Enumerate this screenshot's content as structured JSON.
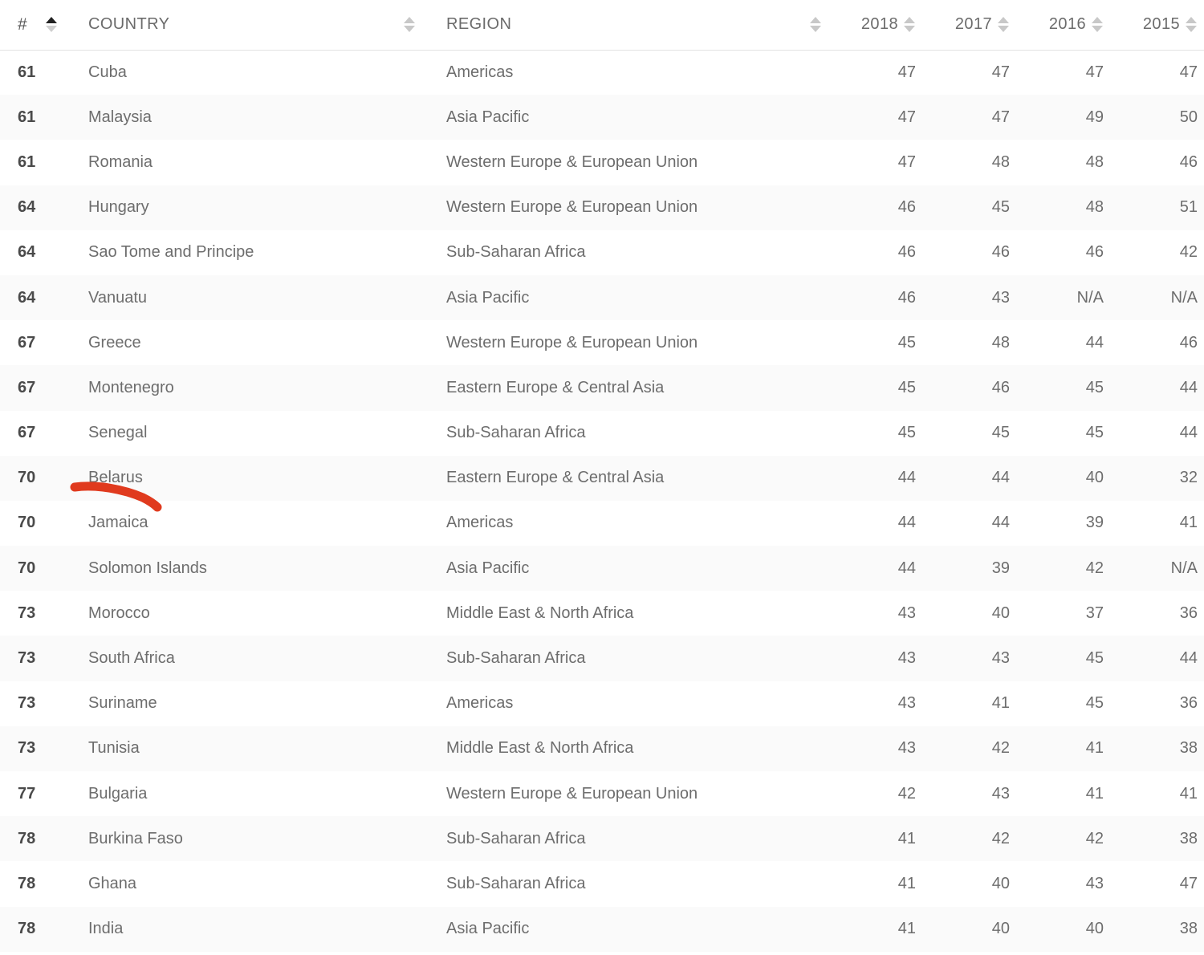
{
  "table": {
    "columns": [
      {
        "key": "rank",
        "label": "#",
        "sort_state": "asc",
        "align": "left"
      },
      {
        "key": "country",
        "label": "COUNTRY",
        "sort_state": "none",
        "align": "left"
      },
      {
        "key": "region",
        "label": "REGION",
        "sort_state": "none",
        "align": "left"
      },
      {
        "key": "y2018",
        "label": "2018",
        "sort_state": "none",
        "align": "right"
      },
      {
        "key": "y2017",
        "label": "2017",
        "sort_state": "none",
        "align": "right"
      },
      {
        "key": "y2016",
        "label": "2016",
        "sort_state": "none",
        "align": "right"
      },
      {
        "key": "y2015",
        "label": "2015",
        "sort_state": "none",
        "align": "right"
      }
    ],
    "rows": [
      {
        "rank": "61",
        "country": "Cuba",
        "region": "Americas",
        "y2018": "47",
        "y2017": "47",
        "y2016": "47",
        "y2015": "47"
      },
      {
        "rank": "61",
        "country": "Malaysia",
        "region": "Asia Pacific",
        "y2018": "47",
        "y2017": "47",
        "y2016": "49",
        "y2015": "50"
      },
      {
        "rank": "61",
        "country": "Romania",
        "region": "Western Europe & European Union",
        "y2018": "47",
        "y2017": "48",
        "y2016": "48",
        "y2015": "46"
      },
      {
        "rank": "64",
        "country": "Hungary",
        "region": "Western Europe & European Union",
        "y2018": "46",
        "y2017": "45",
        "y2016": "48",
        "y2015": "51"
      },
      {
        "rank": "64",
        "country": "Sao Tome and Principe",
        "region": "Sub-Saharan Africa",
        "y2018": "46",
        "y2017": "46",
        "y2016": "46",
        "y2015": "42"
      },
      {
        "rank": "64",
        "country": "Vanuatu",
        "region": "Asia Pacific",
        "y2018": "46",
        "y2017": "43",
        "y2016": "N/A",
        "y2015": "N/A"
      },
      {
        "rank": "67",
        "country": "Greece",
        "region": "Western Europe & European Union",
        "y2018": "45",
        "y2017": "48",
        "y2016": "44",
        "y2015": "46"
      },
      {
        "rank": "67",
        "country": "Montenegro",
        "region": "Eastern Europe & Central Asia",
        "y2018": "45",
        "y2017": "46",
        "y2016": "45",
        "y2015": "44"
      },
      {
        "rank": "67",
        "country": "Senegal",
        "region": "Sub-Saharan Africa",
        "y2018": "45",
        "y2017": "45",
        "y2016": "45",
        "y2015": "44"
      },
      {
        "rank": "70",
        "country": "Belarus",
        "region": "Eastern Europe & Central Asia",
        "y2018": "44",
        "y2017": "44",
        "y2016": "40",
        "y2015": "32"
      },
      {
        "rank": "70",
        "country": "Jamaica",
        "region": "Americas",
        "y2018": "44",
        "y2017": "44",
        "y2016": "39",
        "y2015": "41"
      },
      {
        "rank": "70",
        "country": "Solomon Islands",
        "region": "Asia Pacific",
        "y2018": "44",
        "y2017": "39",
        "y2016": "42",
        "y2015": "N/A"
      },
      {
        "rank": "73",
        "country": "Morocco",
        "region": "Middle East & North Africa",
        "y2018": "43",
        "y2017": "40",
        "y2016": "37",
        "y2015": "36"
      },
      {
        "rank": "73",
        "country": "South Africa",
        "region": "Sub-Saharan Africa",
        "y2018": "43",
        "y2017": "43",
        "y2016": "45",
        "y2015": "44"
      },
      {
        "rank": "73",
        "country": "Suriname",
        "region": "Americas",
        "y2018": "43",
        "y2017": "41",
        "y2016": "45",
        "y2015": "36"
      },
      {
        "rank": "73",
        "country": "Tunisia",
        "region": "Middle East & North Africa",
        "y2018": "43",
        "y2017": "42",
        "y2016": "41",
        "y2015": "38"
      },
      {
        "rank": "77",
        "country": "Bulgaria",
        "region": "Western Europe & European Union",
        "y2018": "42",
        "y2017": "43",
        "y2016": "41",
        "y2015": "41"
      },
      {
        "rank": "78",
        "country": "Burkina Faso",
        "region": "Sub-Saharan Africa",
        "y2018": "41",
        "y2017": "42",
        "y2016": "42",
        "y2015": "38"
      },
      {
        "rank": "78",
        "country": "Ghana",
        "region": "Sub-Saharan Africa",
        "y2018": "41",
        "y2017": "40",
        "y2016": "43",
        "y2015": "47"
      },
      {
        "rank": "78",
        "country": "India",
        "region": "Asia Pacific",
        "y2018": "41",
        "y2017": "40",
        "y2016": "40",
        "y2015": "38"
      }
    ]
  },
  "annotation": {
    "type": "underline-stroke",
    "target_row_country": "Belarus",
    "color": "#e03a1e"
  },
  "icons": {
    "sort_both": "sort-both-icon",
    "sort_asc": "sort-ascending-icon"
  }
}
